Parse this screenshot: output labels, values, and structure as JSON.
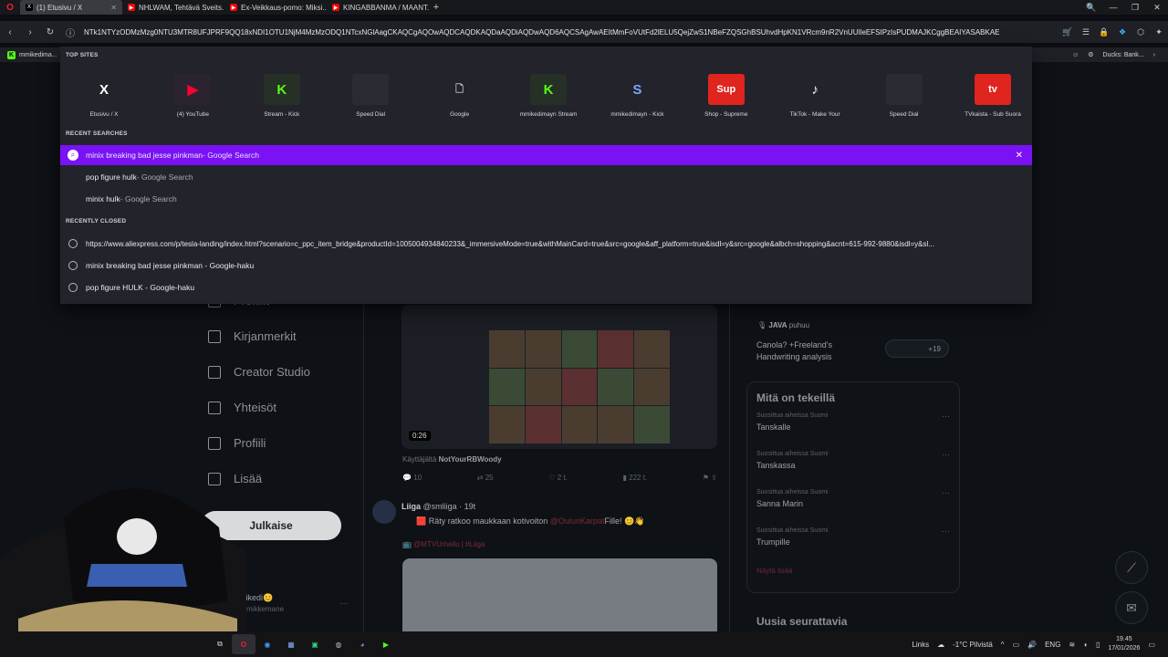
{
  "browser": {
    "tabs": [
      {
        "label": "(1) Etusivu / X",
        "active": true,
        "fav": "X",
        "fav_color": "#000000"
      },
      {
        "label": "NHLWAM, Tehtävä Sveits...",
        "active": false,
        "fav": "▶",
        "fav_color": "#ff0000"
      },
      {
        "label": "Ex-Veikkaus-pomo: Miksi...",
        "active": false,
        "fav": "▶",
        "fav_color": "#ff0000"
      },
      {
        "label": "KINGABBANMA / MAANT...",
        "active": false,
        "fav": "▶",
        "fav_color": "#ff0000"
      }
    ],
    "new_tab": "+",
    "url": "NTk1NTYzODMzMzg0NTU3MTR8UFJPRF9QQ18xNDI1OTU1NjM4MzMzODQ1NTcxNGlAagCKAQCgAQOwAQDCAQDKAQDaAQDiAQDwAQD6AQCSAgAwAEItMmFoVUtFd2lELU5QejZwS1NBeFZQSGhBSUhvdHpKN1VRcm9nR2VnUUlIeEFSIPzIsPUDMAJKCggBEAIYASABKAE",
    "bookmark_item": "mmikedima...",
    "bookmark_right": "Ducks: Bank..."
  },
  "dropdown": {
    "top_sites_label": "TOP SITES",
    "top_sites": [
      {
        "label": "Etusivu / X",
        "icon": "x-logo",
        "glyph": "X",
        "bg": "#23232b",
        "fg": "#ffffff"
      },
      {
        "label": "(4) YouTube",
        "icon": "youtube-logo",
        "glyph": "▶",
        "bg": "#2b2430",
        "fg": "#ff0033"
      },
      {
        "label": "Stream - Kick",
        "icon": "kick-logo",
        "glyph": "K",
        "bg": "#263026",
        "fg": "#53fc18"
      },
      {
        "label": "Speed Dial",
        "icon": "blank-tile",
        "glyph": "",
        "bg": "#2a2b33",
        "fg": "#ffffff"
      },
      {
        "label": "Google",
        "icon": "document-icon",
        "glyph": "🗋",
        "bg": "#23232b",
        "fg": "#cfcfd6"
      },
      {
        "label": "mmikedimayn Stream",
        "icon": "kick-logo",
        "glyph": "K",
        "bg": "#263026",
        "fg": "#53fc18"
      },
      {
        "label": "mmikedimayn - Kick",
        "icon": "swirl-logo",
        "glyph": "S",
        "bg": "#23232b",
        "fg": "#7aa6ff"
      },
      {
        "label": "Shop - Supreme",
        "icon": "supreme-logo",
        "glyph": "Sup",
        "bg": "#e0241e",
        "fg": "#ffffff"
      },
      {
        "label": "TikTok - Make Your",
        "icon": "tiktok-logo",
        "glyph": "♪",
        "bg": "#23232b",
        "fg": "#ffffff"
      },
      {
        "label": "Speed Dial",
        "icon": "blank-tile",
        "glyph": "",
        "bg": "#2a2b33",
        "fg": "#ffffff"
      },
      {
        "label": "TVkaista - Sub Suora",
        "icon": "tv-logo",
        "glyph": "tv",
        "bg": "#e0241e",
        "fg": "#ffffff"
      }
    ],
    "recent_searches_label": "RECENT SEARCHES",
    "recent_searches": [
      {
        "query": "minix breaking bad jesse pinkman",
        "source": " - Google Search"
      },
      {
        "query": "pop figure hulk",
        "source": " - Google Search"
      },
      {
        "query": "minix hulk",
        "source": " - Google Search"
      }
    ],
    "recently_closed_label": "RECENTLY CLOSED",
    "recently_closed": [
      "https://www.aliexpress.com/p/tesla-landing/index.html?scenario=c_ppc_item_bridge&productId=1005004934840233&_immersiveMode=true&withMainCard=true&src=google&aff_platform=true&isdl=y&src=google&albch=shopping&acnt=615-992-9880&isdl=y&sl...",
      "minix breaking bad jesse pinkman - Google-haku",
      "pop figure HULK - Google-haku"
    ]
  },
  "page": {
    "sidebar": [
      "Profiilit",
      "Kirjanmerkit",
      "Creator Studio",
      "Yhteisöt",
      "Profiili",
      "Lisää"
    ],
    "post_button": "Julkaise",
    "user_name": "mikedi😊",
    "user_handle": "@mikkemane",
    "video_duration": "0:26",
    "via_prefix": "Käyttäjältä ",
    "via_user": "NotYourRBWoody",
    "actions": [
      "10",
      "25",
      "2 t.",
      "222 t."
    ],
    "tweet2_author": "Liiga",
    "tweet2_handle": "@smliiga · 19t",
    "tweet2_text_a": "🟥 Räty ratkoo maukkaan kotivoiton ",
    "tweet2_mention": "@OulunKarpat",
    "tweet2_text_b": "Fille! 😊👋",
    "tweet2_tags": "📺 @MTVUrheilu | #Liiga",
    "java_user": "JAVA",
    "java_suffix": " puhuu",
    "java_text": "Canola? +Freeland's Handwriting analysis",
    "java_count": "+19",
    "trends_title": "Mitä on tekeillä",
    "trends": [
      {
        "meta": "Suosittua aiheissa Suomi",
        "name": "Tanskalle"
      },
      {
        "meta": "Suosittua aiheissa Suomi",
        "name": "Tanskassa"
      },
      {
        "meta": "Suosittua aiheissa Suomi",
        "name": "Sanna Marin"
      },
      {
        "meta": "Suosittua aiheissa Suomi",
        "name": "Trumpille"
      }
    ],
    "show_more": "Näytä lisää",
    "follow_title": "Uusia seurattavia"
  },
  "taskbar": {
    "links": "Links",
    "weather": "-1°C  Pilvistä",
    "lang": "ENG",
    "time": "19.45",
    "date": "17/01/2026"
  }
}
